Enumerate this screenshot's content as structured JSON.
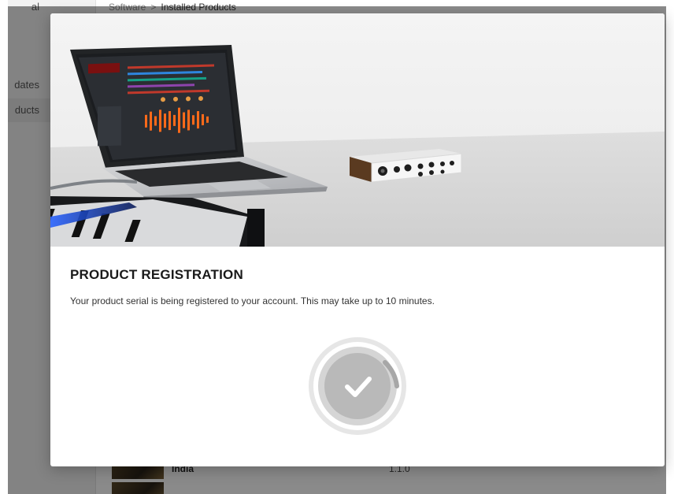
{
  "sidebar": {
    "items": [
      {
        "label": "al"
      },
      {
        "label": "dates"
      },
      {
        "label": "ducts"
      }
    ]
  },
  "breadcrumb": {
    "parent": "Software",
    "separator": ">",
    "current": "Installed Products"
  },
  "product_list": {
    "rows": [
      {
        "name": "India",
        "version": "1.1.0"
      },
      {
        "name": "",
        "version": ""
      }
    ]
  },
  "modal": {
    "title": "PRODUCT REGISTRATION",
    "message": "Your product serial is being registered to your account. This may take up to 10 minutes.",
    "status_icon": "checkmark-icon"
  },
  "colors": {
    "overlay": "#000000",
    "modal_bg": "#ffffff",
    "status_ring_outer": "#e3e3e3",
    "status_ring_inner": "#c9c9c9",
    "status_fill": "#b8b8b8",
    "waveform_orange": "#ff6a1a"
  }
}
